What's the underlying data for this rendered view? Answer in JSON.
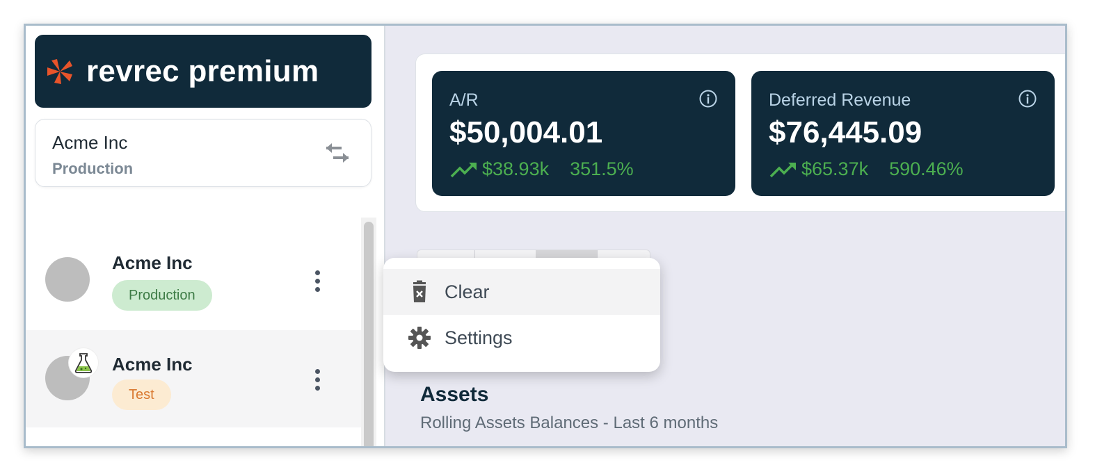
{
  "brand": {
    "name": "revrec premium",
    "accent": "#e8542a",
    "dark": "#102a3a"
  },
  "org_switcher": {
    "org_name": "Acme Inc",
    "environment": "Production",
    "icon": "swap-arrows-icon"
  },
  "org_list": [
    {
      "name": "Acme Inc",
      "badge": "Production",
      "badge_color": "#cdebd0"
    },
    {
      "name": "Acme Inc",
      "badge": "Test",
      "badge_color": "#fcebd2",
      "icon": "flask-icon"
    }
  ],
  "metrics": [
    {
      "label": "A/R",
      "value": "$50,004.01",
      "change": "$38.93k",
      "percent": "351.5%"
    },
    {
      "label": "Deferred Revenue",
      "value": "$76,445.09",
      "change": "$65.37k",
      "percent": "590.46%"
    }
  ],
  "context_menu": {
    "items": [
      {
        "label": "Clear",
        "icon": "trash-icon"
      },
      {
        "label": "Settings",
        "icon": "gear-icon"
      }
    ]
  },
  "section": {
    "title": "Assets",
    "subtitle": "Rolling Assets Balances - Last 6 months"
  },
  "colors": {
    "positive": "#4caf50",
    "info": "#b9d3e6"
  }
}
